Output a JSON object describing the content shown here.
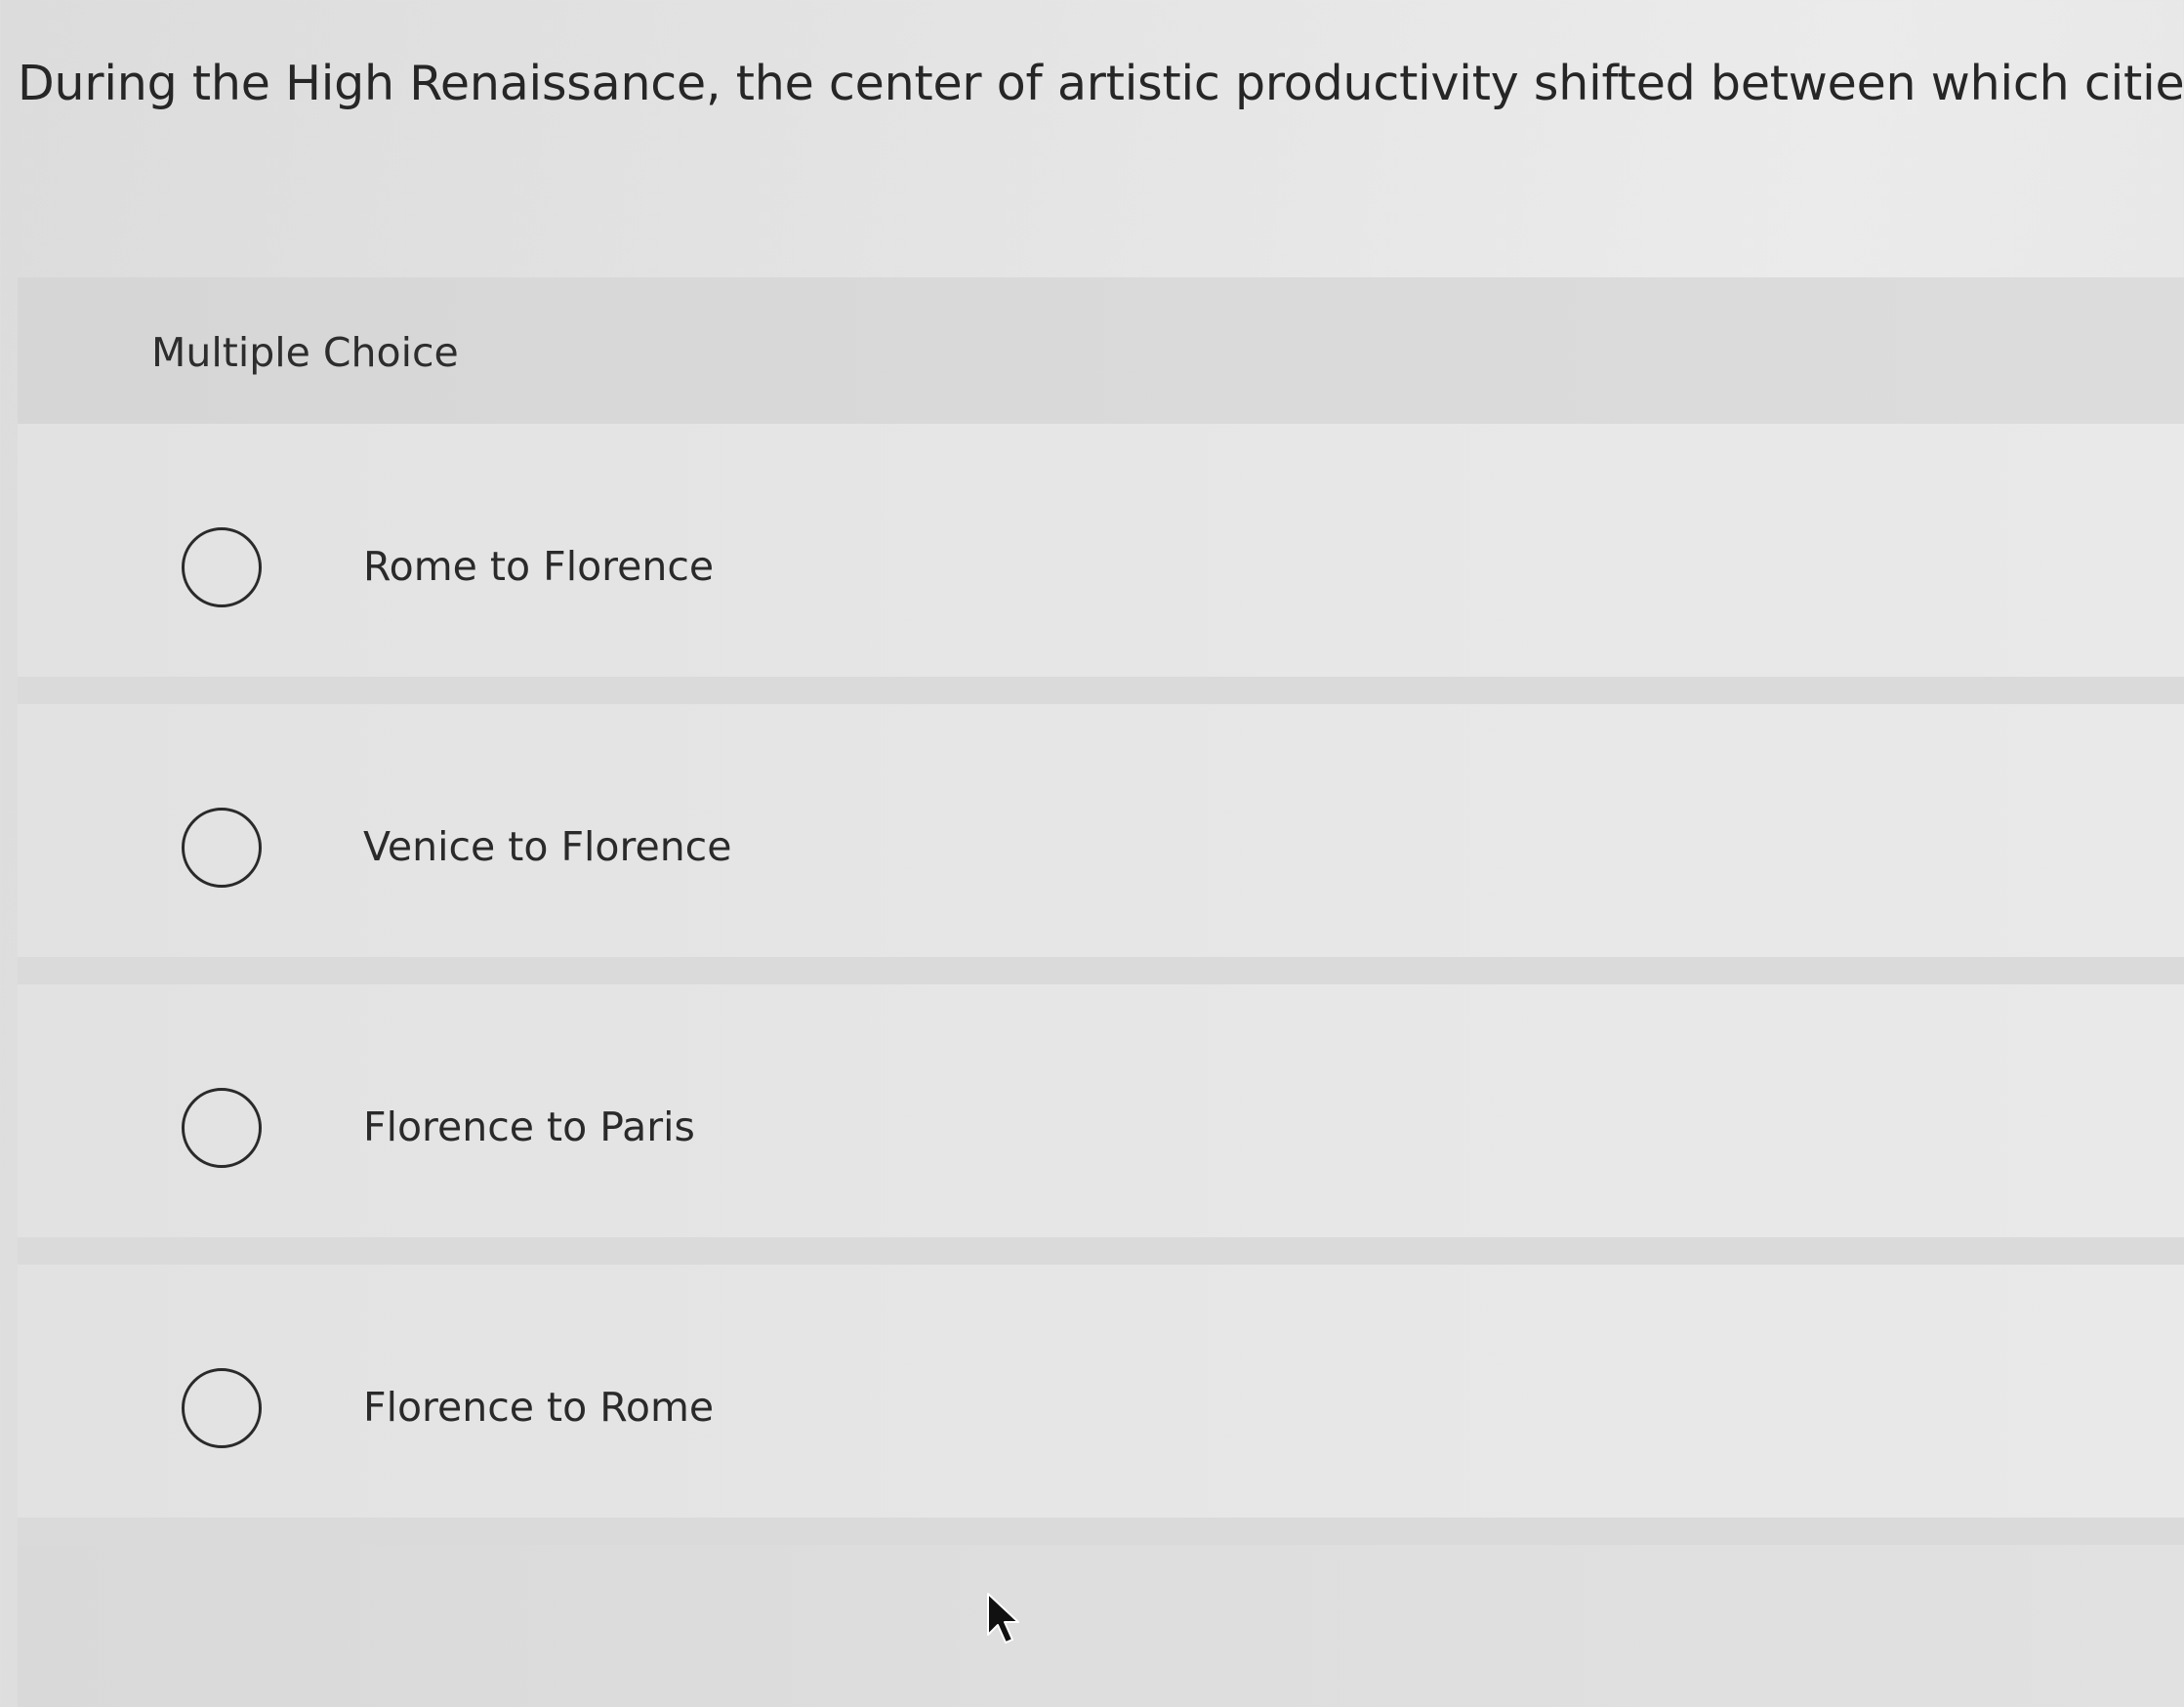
{
  "question": {
    "text": "During the High Renaissance, the center of artistic productivity shifted between which cities?"
  },
  "answer_panel": {
    "type_label": "Multiple Choice",
    "choices": [
      {
        "label": "Rome to Florence",
        "selected": false
      },
      {
        "label": "Venice to Florence",
        "selected": false
      },
      {
        "label": "Florence to Paris",
        "selected": false
      },
      {
        "label": "Florence to Rome",
        "selected": false
      }
    ]
  },
  "icons": {
    "radio": "radio-button-icon",
    "cursor": "mouse-pointer-icon"
  }
}
